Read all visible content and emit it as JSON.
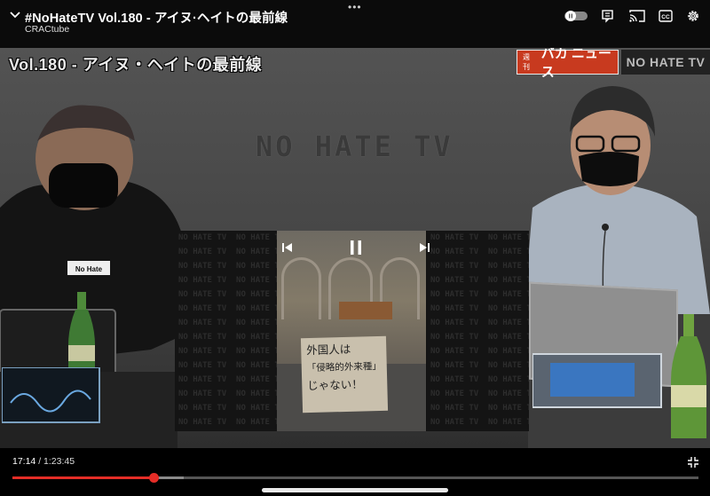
{
  "header": {
    "title": "#NoHateTV Vol.180 - アイヌ·ヘイトの最前線",
    "channel": "CRACtube",
    "more_glyph": "•••",
    "icons": [
      "collapse-chevron-icon",
      "autoplay-toggle-icon",
      "save-to-playlist-icon",
      "cast-icon",
      "captions-icon",
      "settings-gear-icon"
    ]
  },
  "video": {
    "overlay_title": "Vol.180 - アイヌ・ヘイトの最前線",
    "badge_small": "週刊",
    "badge_big": "バカ ニュース",
    "badge_right": "NO HATE TV",
    "wall_logo": "NO HATE TV",
    "laptop_sticker": "No Hate",
    "pip": {
      "side_text": "NO HATE TV  NO HATE TV",
      "sign_lines": [
        "外国人は",
        "「侵略的外来種」",
        "じゃない！"
      ],
      "controls": [
        "previous-icon",
        "pause-icon",
        "next-icon"
      ]
    }
  },
  "player": {
    "current_time": "17:14",
    "separator": " / ",
    "duration": "1:23:45",
    "progress": 0.206,
    "buffered": 0.25,
    "colors": {
      "accent": "#e52d27",
      "track": "#555555"
    }
  }
}
